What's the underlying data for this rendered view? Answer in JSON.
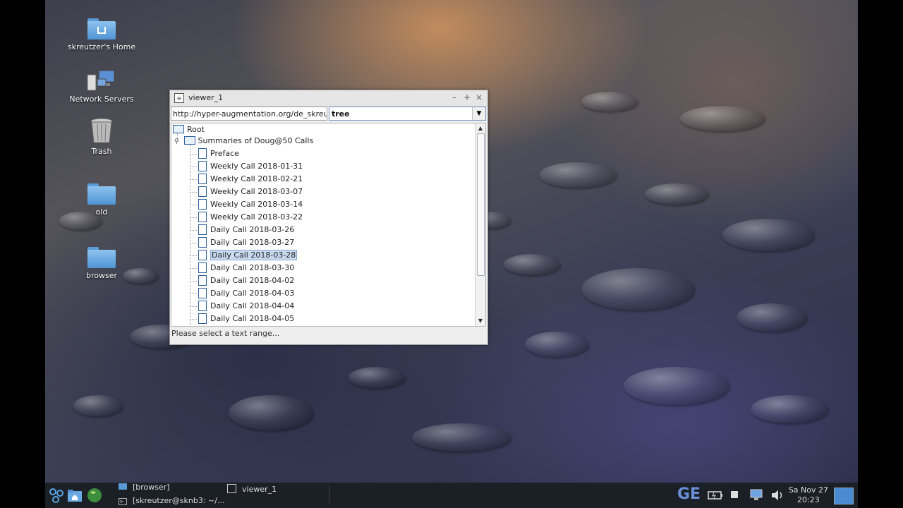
{
  "desktop": {
    "icons": [
      {
        "label": "skreutzer's Home",
        "icon": "home-folder-icon"
      },
      {
        "label": "Network Servers",
        "icon": "network-servers-icon"
      },
      {
        "label": "Trash",
        "icon": "trash-icon"
      },
      {
        "label": "old",
        "icon": "folder-icon"
      },
      {
        "label": "browser",
        "icon": "folder-icon"
      }
    ]
  },
  "window": {
    "title": "viewer_1",
    "controls": {
      "minimize": "–",
      "maximize": "+",
      "close": "×"
    },
    "url": "http://hyper-augmentation.org/de_skreutzer_",
    "view_mode": "tree",
    "status": "Please select a text range...",
    "tree": {
      "root": "Root",
      "folder": "Summaries of Doug@50 Calls",
      "items": [
        "Preface",
        "Weekly Call 2018-01-31",
        "Weekly Call 2018-02-21",
        "Weekly Call 2018-03-07",
        "Weekly Call 2018-03-14",
        "Weekly Call 2018-03-22",
        "Daily Call 2018-03-26",
        "Daily Call 2018-03-27",
        "Daily Call 2018-03-28",
        "Daily Call 2018-03-30",
        "Daily Call 2018-04-02",
        "Daily Call 2018-04-03",
        "Daily Call 2018-04-04",
        "Daily Call 2018-04-05"
      ],
      "selected_item": "Daily Call 2018-03-28"
    }
  },
  "taskbar": {
    "tasks": [
      {
        "label": "[browser]",
        "icon": "folder-icon"
      },
      {
        "label": "[skreutzer@sknb3: ~/...",
        "icon": "terminal-icon"
      },
      {
        "label": "viewer_1",
        "icon": "java-app-icon"
      }
    ],
    "tray_text": "GE",
    "clock": {
      "day": "Sa Nov 27",
      "time": "20:23"
    }
  }
}
